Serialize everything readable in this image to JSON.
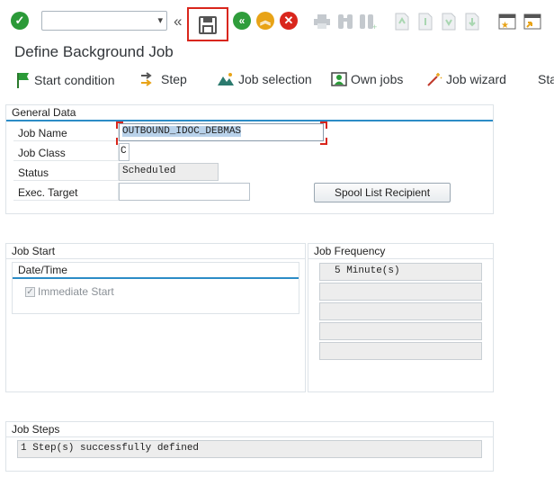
{
  "toolbar": {
    "command_field_value": "",
    "icons": [
      "check-icon",
      "command-field",
      "back-arrows-icon",
      "save-icon",
      "back-icon",
      "exit-icon",
      "cancel-icon",
      "print-icon",
      "find-icon",
      "find-next-icon",
      "first-page-icon",
      "previous-page-icon",
      "next-page-icon",
      "last-page-icon",
      "create-session-icon",
      "shortcut-icon"
    ]
  },
  "page": {
    "title": "Define Background Job"
  },
  "app_toolbar": {
    "start_condition": "Start condition",
    "step": "Step",
    "job_selection": "Job selection",
    "own_jobs": "Own jobs",
    "job_wizard": "Job wizard",
    "more": "Sta"
  },
  "general": {
    "title": "General Data",
    "job_name_label": "Job Name",
    "job_name_value": "OUTBOUND_IDOC_DEBMAS",
    "job_class_label": "Job Class",
    "job_class_value": "C",
    "status_label": "Status",
    "status_value": "Scheduled",
    "exec_target_label": "Exec. Target",
    "exec_target_value": "",
    "spool_button": "Spool List Recipient"
  },
  "job_start": {
    "title": "Job Start",
    "sub_title": "Date/Time",
    "immediate_label": "Immediate Start",
    "immediate_checked": true
  },
  "job_frequency": {
    "title": "Job Frequency",
    "rows": [
      "5 Minute(s)",
      "",
      "",
      "",
      ""
    ]
  },
  "job_steps": {
    "title": "Job Steps",
    "value": "1 Step(s) successfully defined"
  },
  "colors": {
    "accent": "#2c8cc6",
    "ok": "#2b9a38",
    "back": "#2f9d3b",
    "exit": "#e8a317",
    "cancel": "#d9261c"
  }
}
